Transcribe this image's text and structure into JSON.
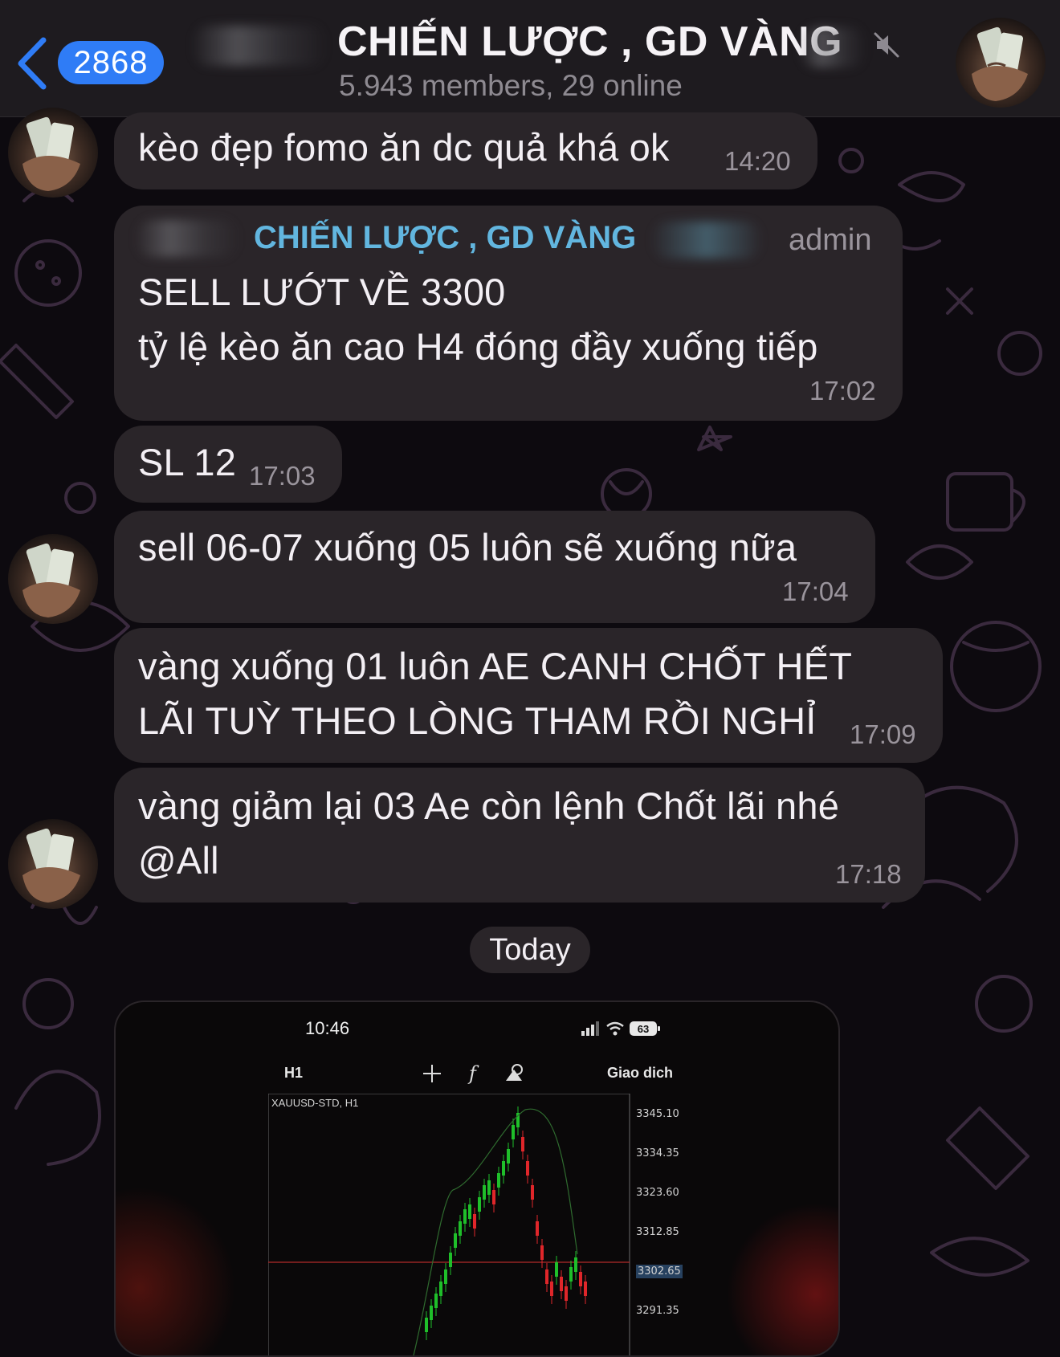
{
  "header": {
    "back_badge": "2868",
    "title": "CHIẾN LƯỢC , GD VÀNG",
    "subtitle": "5.943 members, 29 online"
  },
  "messages": [
    {
      "text": "kèo đẹp fomo ăn dc quả khá ok",
      "time": "14:20"
    },
    {
      "sender": "CHIẾN LƯỢC , GD VÀNG",
      "role": "admin",
      "lines": [
        "SELL LƯỚT VỀ 3300",
        "tỷ lệ kèo ăn cao H4 đóng đầy xuống tiếp"
      ],
      "time": "17:02"
    },
    {
      "text": "SL 12",
      "time": "17:03"
    },
    {
      "text": "sell 06-07 xuống 05 luôn sẽ xuống nữa",
      "time": "17:04"
    },
    {
      "lines": [
        "vàng xuống 01 luôn AE CANH CHỐT HẾT",
        "LÃI TUỲ THEO LÒNG THAM RỒI NGHỈ"
      ],
      "time": "17:09"
    },
    {
      "lines": [
        "vàng giảm lại 03 Ae còn lệnh Chốt lãi nhé",
        "@All"
      ],
      "time": "17:18"
    }
  ],
  "date_separator": "Today",
  "photo": {
    "phone_time": "10:46",
    "battery": "63",
    "timeframe": "H1",
    "trade_label": "Giao dich",
    "symbol": "XAUUSD-STD, H1",
    "price_ticks": [
      "3345.10",
      "3334.35",
      "3323.60",
      "3312.85",
      "3302.65",
      "3291.35"
    ],
    "current_price": "3302.65"
  },
  "colors": {
    "header_bg": "#1e1b1f",
    "bubble_bg": "#2a2529",
    "badge": "#2f7cf6",
    "sender_name": "#62b6df",
    "candle_up": "#1fbf2a",
    "candle_down": "#e0262a"
  }
}
